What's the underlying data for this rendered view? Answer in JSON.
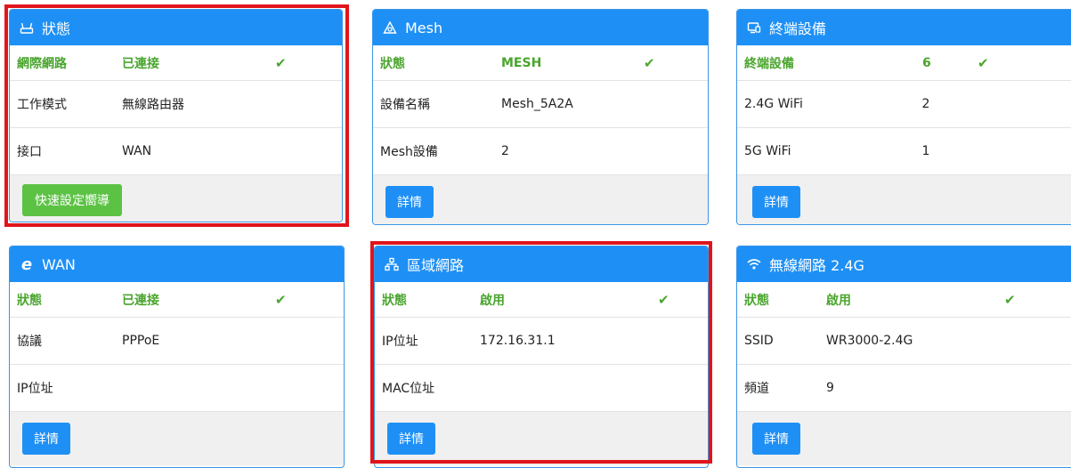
{
  "cards": {
    "status": {
      "title": "狀態",
      "icon": "router-icon",
      "header_row": {
        "label": "網際網路",
        "value": "已連接",
        "check": "✔"
      },
      "rows": [
        {
          "label": "工作模式",
          "value": "無線路由器"
        },
        {
          "label": "接口",
          "value": "WAN"
        }
      ],
      "button": "快速設定嚮導"
    },
    "mesh": {
      "title": "Mesh",
      "icon": "mesh-icon",
      "header_row": {
        "label": "狀態",
        "value": "MESH",
        "check": "✔"
      },
      "rows": [
        {
          "label": "設備名稱",
          "value": "Mesh_5A2A"
        },
        {
          "label": "Mesh設備",
          "value": "2"
        }
      ],
      "button": "詳情"
    },
    "devices": {
      "title": "終端設備",
      "icon": "monitor-icon",
      "header_row": {
        "label": "終端設備",
        "value": "6",
        "check": "✔"
      },
      "rows": [
        {
          "label": "2.4G WiFi",
          "value": "2"
        },
        {
          "label": "5G WiFi",
          "value": "1"
        }
      ],
      "button": "詳情"
    },
    "wan": {
      "title": "WAN",
      "icon": "ie-icon",
      "header_row": {
        "label": "狀態",
        "value": "已連接",
        "check": "✔"
      },
      "rows": [
        {
          "label": "協議",
          "value": "PPPoE"
        },
        {
          "label": "IP位址",
          "value": ""
        }
      ],
      "button": "詳情"
    },
    "lan": {
      "title": "區域網路",
      "icon": "lan-icon",
      "header_row": {
        "label": "狀態",
        "value": "啟用",
        "check": "✔"
      },
      "rows": [
        {
          "label": "IP位址",
          "value": "172.16.31.1"
        },
        {
          "label": "MAC位址",
          "value": ""
        }
      ],
      "button": "詳情"
    },
    "wifi24": {
      "title": "無線網路 2.4G",
      "icon": "wifi-icon",
      "header_row": {
        "label": "狀態",
        "value": "啟用",
        "check": "✔"
      },
      "rows": [
        {
          "label": "SSID",
          "value": "WR3000-2.4G"
        },
        {
          "label": "頻道",
          "value": "9"
        }
      ],
      "button": "詳情"
    }
  },
  "colors": {
    "header": "#1e90f5",
    "status_green": "#4aa52e",
    "highlight_red": "#e0151c",
    "wizard_button": "#5cc244"
  }
}
